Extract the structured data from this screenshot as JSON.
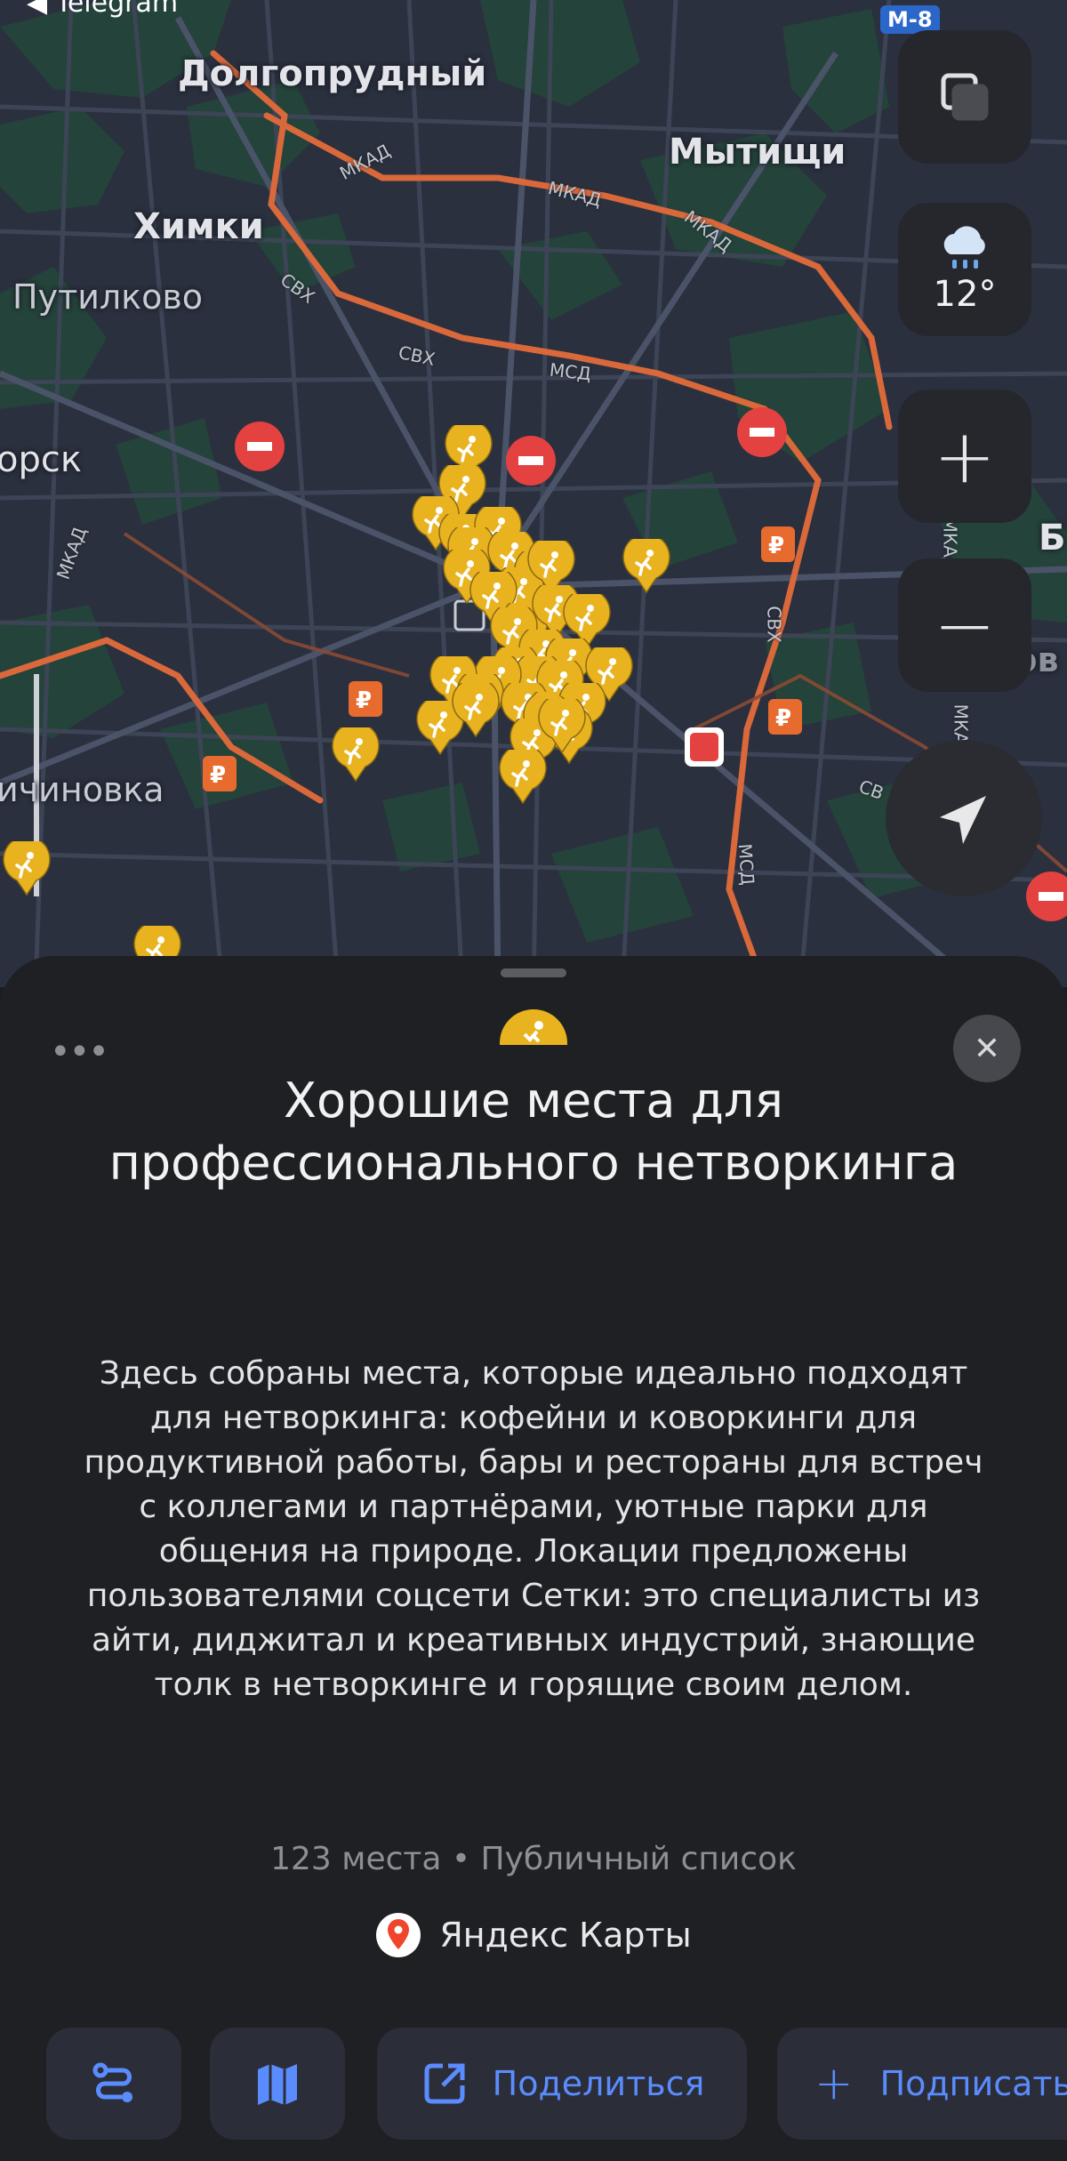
{
  "status_bar": {
    "back_app": "Telegram"
  },
  "map": {
    "highway_badge": "M-8",
    "towns": [
      "Долгопрудный",
      "Мытищи",
      "Химки",
      "Путилково",
      "орск",
      "ичиновка",
      "Б",
      "Реутов"
    ],
    "road_labels": [
      "МКАД",
      "МКАД",
      "МКАД",
      "СВХ",
      "СВХ",
      "МСД",
      "МКАД",
      "СВХ",
      "МКАД",
      "МСД",
      "СВ",
      "МКАД"
    ],
    "weather": {
      "temperature": "12°",
      "icon": "cloud-rain-icon"
    },
    "controls": {
      "plus": "+",
      "minus": "−"
    },
    "pin_color": "#e9b320"
  },
  "sheet": {
    "title": "Хорошие места для профессионального нетворкинга",
    "description": "Здесь собраны места, которые идеально подходят для нетворкинга: кофейни и коворкинги для продуктивной работы, бары и рестораны для встреч с коллегами и партнёрами, уютные парки для общения на природе. Локации предложены пользователями соцсети Сетки: это специалисты из айти, диджитал и креативных индустрий, знающие толк в нетворкинге и горящие своим делом.",
    "meta": "123 места • Публичный список",
    "source": "Яндекс Карты",
    "buttons": {
      "route": "",
      "map": "",
      "share": "Поделиться",
      "subscribe": "Подписаться"
    },
    "accent_color": "#5b8cff"
  }
}
